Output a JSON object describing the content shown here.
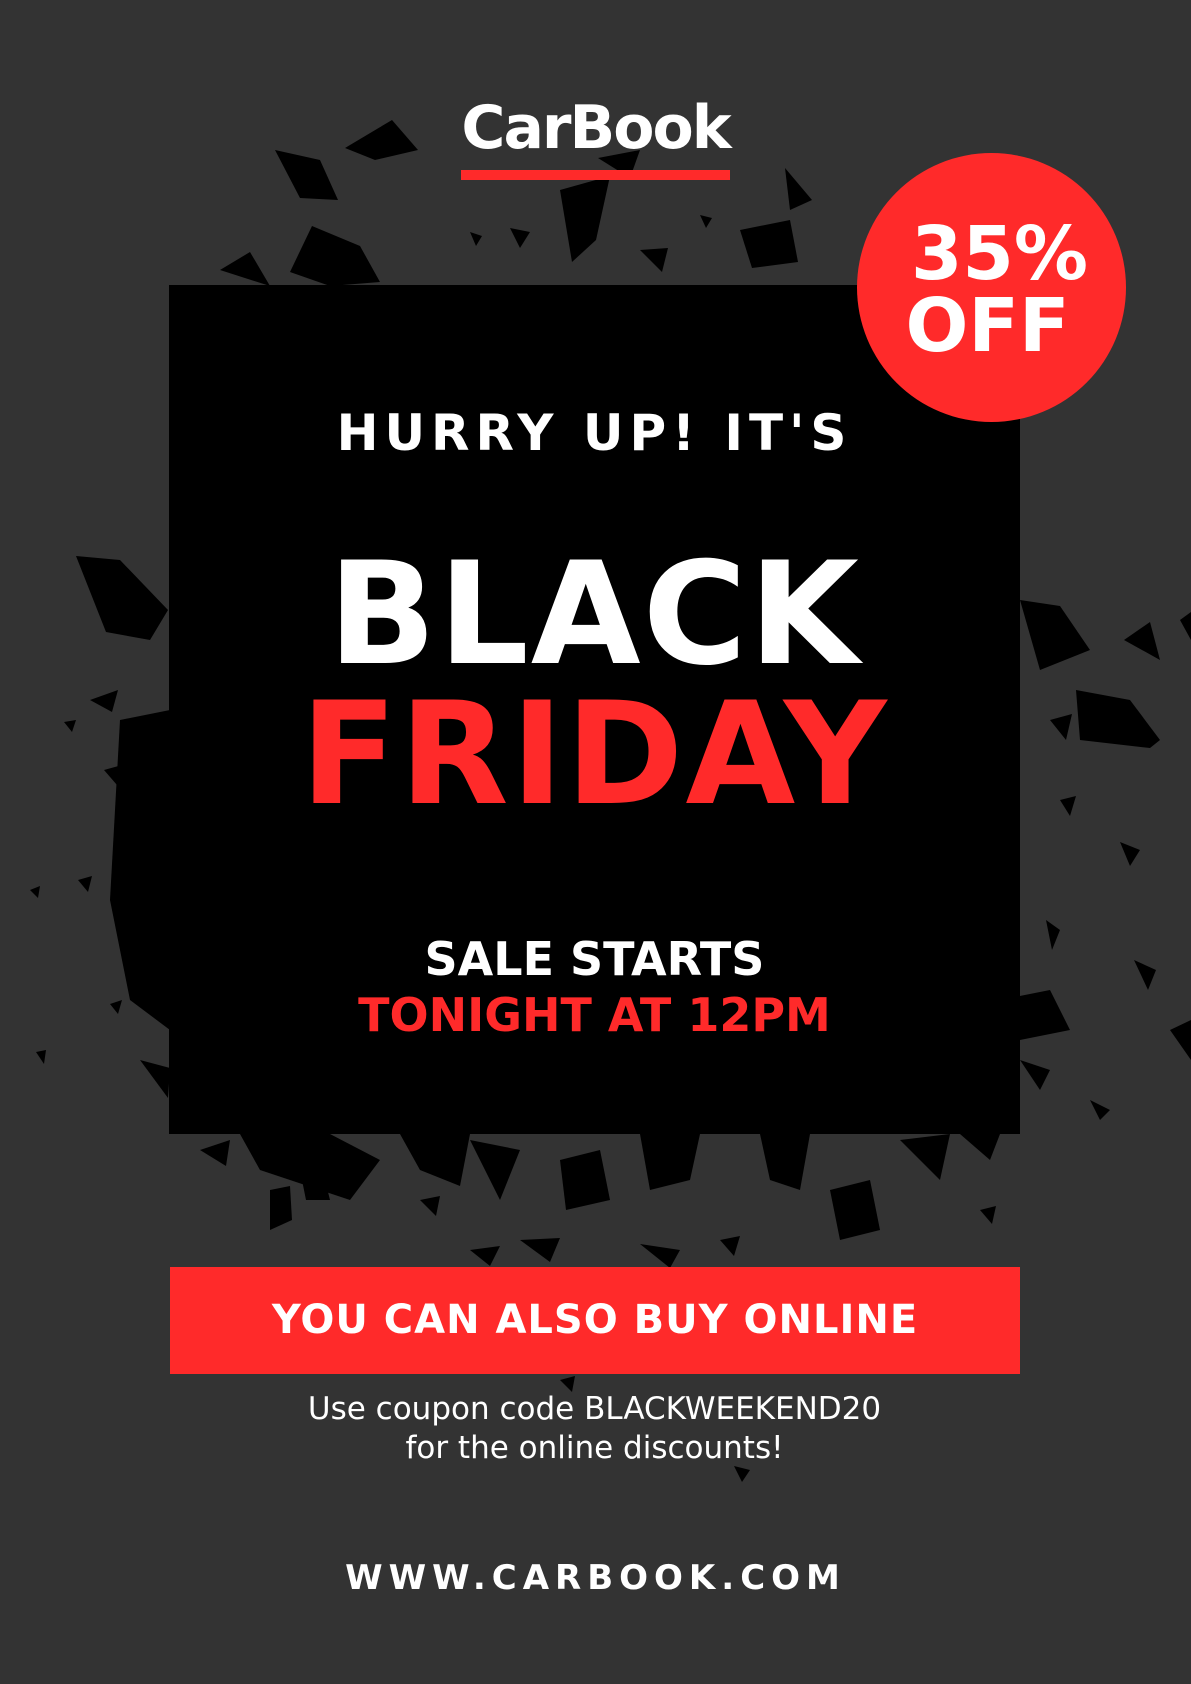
{
  "brand": {
    "logo_text": "CarBook",
    "accent_color": "#ff2a2a",
    "background_color": "#333333"
  },
  "badge": {
    "line1": "35%",
    "line2": "OFF"
  },
  "headline": {
    "intro": "HURRY UP! IT'S",
    "word1": "BLACK",
    "word2": "FRIDAY"
  },
  "sale": {
    "line1": "SALE STARTS",
    "line2": "TONIGHT AT 12PM"
  },
  "cta": {
    "label": "YOU CAN ALSO BUY ONLINE"
  },
  "coupon": {
    "line1": "Use coupon code BLACKWEEKEND20",
    "line2": "for the online discounts!"
  },
  "footer": {
    "website": "WWW.CARBOOK.COM"
  }
}
